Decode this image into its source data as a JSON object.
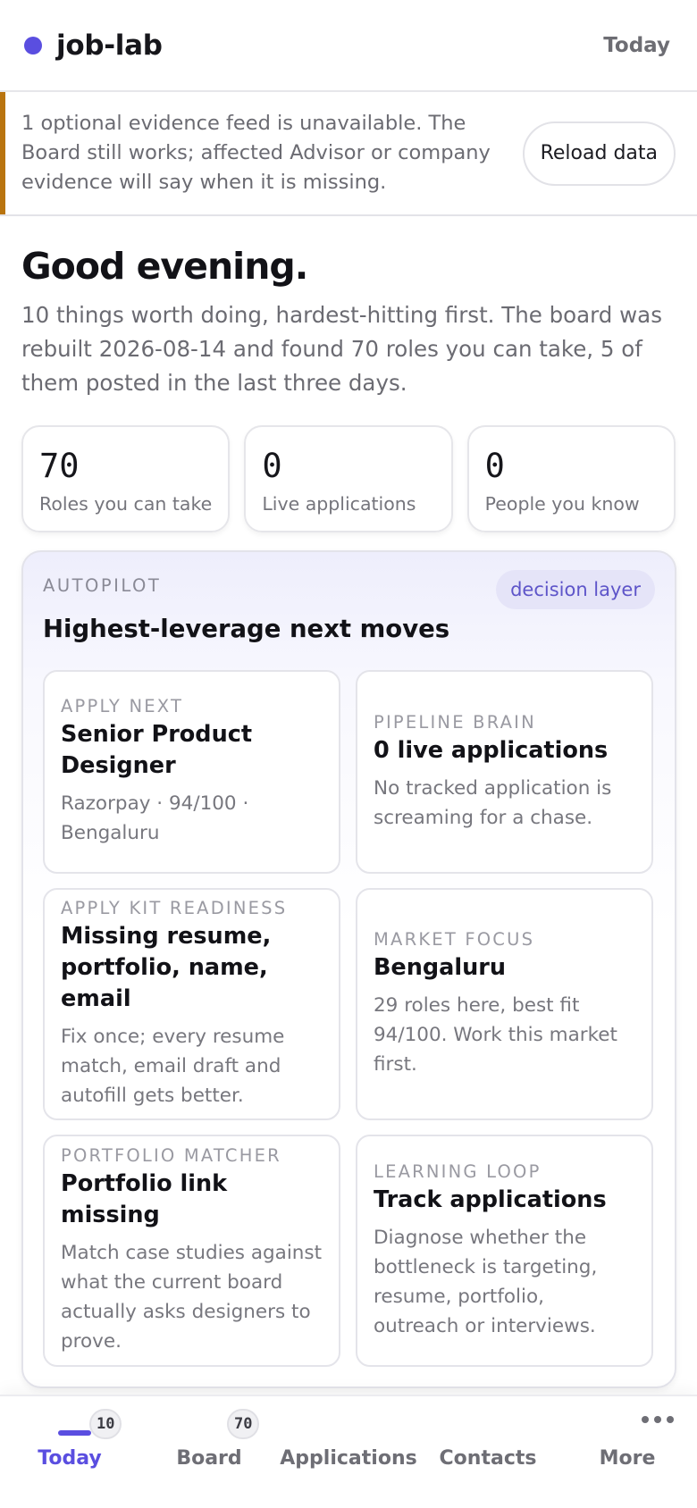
{
  "header": {
    "brand": "job-lab",
    "right_label": "Today"
  },
  "banner": {
    "message": "1 optional evidence feed is unavailable. The Board still works; affected Advisor or company evidence will say when it is missing.",
    "action_label": "Reload data",
    "accent_color": "#b9740f"
  },
  "greeting": {
    "title": "Good evening.",
    "subtitle": "10 things worth doing, hardest-hitting first. The board was rebuilt 2026-08-14 and found 70 roles you can take, 5 of them posted in the last three days."
  },
  "stats": [
    {
      "value": "70",
      "label": "Roles you can take"
    },
    {
      "value": "0",
      "label": "Live applications"
    },
    {
      "value": "0",
      "label": "People you know"
    }
  ],
  "autopilot": {
    "kicker": "AUTOPILOT",
    "chip": "decision layer",
    "title": "Highest-leverage next moves",
    "cards": [
      {
        "kicker": "APPLY NEXT",
        "title": "Senior Product Designer",
        "body": "Razorpay · 94/100 · Bengaluru"
      },
      {
        "kicker": "PIPELINE BRAIN",
        "title": "0 live applications",
        "body": "No tracked application is screaming for a chase."
      },
      {
        "kicker": "APPLY KIT READINESS",
        "title": "Missing resume, portfolio, name, email",
        "body": "Fix once; every resume match, email draft and autofill gets better."
      },
      {
        "kicker": "MARKET FOCUS",
        "title": "Bengaluru",
        "body": "29 roles here, best fit 94/100. Work this market first."
      },
      {
        "kicker": "PORTFOLIO MATCHER",
        "title": "Portfolio link missing",
        "body": "Match case studies against what the current board actually asks designers to prove."
      },
      {
        "kicker": "LEARNING LOOP",
        "title": "Track applications",
        "body": "Diagnose whether the bottleneck is targeting, resume, portfolio, outreach or interviews."
      }
    ]
  },
  "tabs": [
    {
      "label": "Today",
      "badge": "10",
      "active": true
    },
    {
      "label": "Board",
      "badge": "70"
    },
    {
      "label": "Applications"
    },
    {
      "label": "Contacts"
    },
    {
      "label": "More",
      "icon": "more-dots-icon"
    }
  ],
  "colors": {
    "accent": "#5a4ee0",
    "warning": "#b9740f"
  }
}
